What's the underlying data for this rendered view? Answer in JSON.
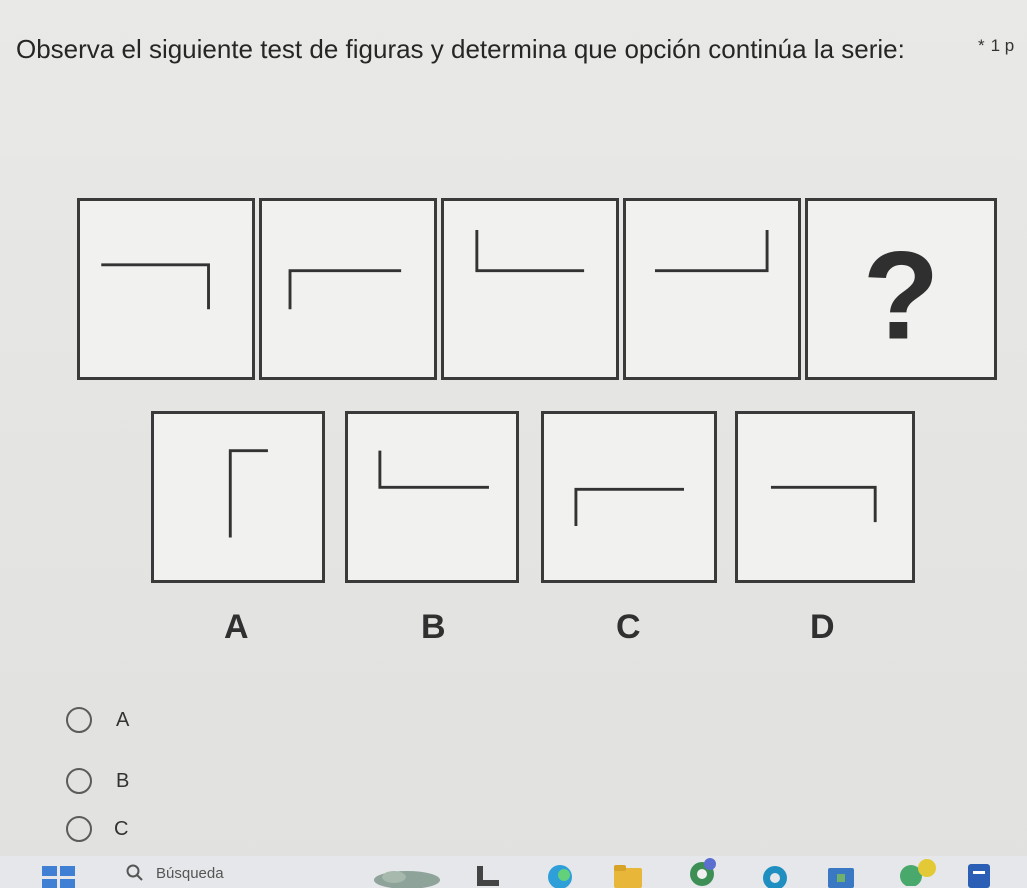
{
  "question": {
    "text": "Observa el siguiente test de figuras y determina que opción continúa la serie:",
    "required_marker": "*",
    "points": "1 p"
  },
  "sequence": {
    "panels": [
      "corner-top-right",
      "corner-top-left",
      "corner-bottom-left",
      "corner-bottom-right",
      "question-mark"
    ],
    "question_symbol": "?"
  },
  "answer_figures": [
    {
      "letter": "A",
      "shape": "corner-top-left-tall"
    },
    {
      "letter": "B",
      "shape": "corner-bottom-left"
    },
    {
      "letter": "C",
      "shape": "corner-top-left"
    },
    {
      "letter": "D",
      "shape": "corner-top-right"
    }
  ],
  "choices": [
    {
      "label": "A"
    },
    {
      "label": "B"
    },
    {
      "label": "C"
    }
  ],
  "taskbar": {
    "search_placeholder": "Búsqueda",
    "icons": [
      "windows-icon",
      "search-icon",
      "widgets-icon",
      "file-explorer-icon",
      "edge-icon",
      "folder-icon",
      "chrome-icon",
      "store-icon",
      "photos-icon",
      "word-icon"
    ]
  }
}
